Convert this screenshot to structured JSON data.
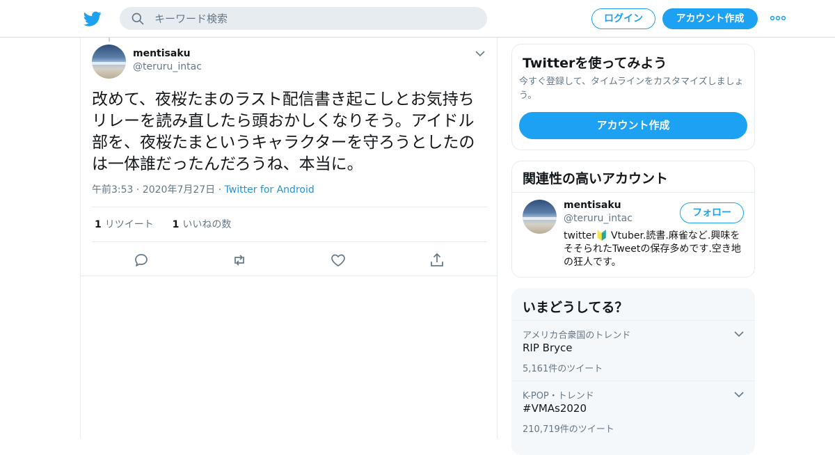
{
  "header": {
    "search_placeholder": "キーワード検索",
    "login_label": "ログイン",
    "signup_label": "アカウント作成"
  },
  "tweet": {
    "name": "mentisaku",
    "handle": "@teruru_intac",
    "text": "改めて、夜桜たまのラスト配信書き起こしとお気持ちリレーを読み直したら頭おかしくなりそう。アイドル部を、夜桜たまというキャラクターを守ろうとしたのは一体誰だったんだろうね、本当に。",
    "time": "午前3:53",
    "date": "2020年7月27日",
    "source": "Twitter for Android",
    "retweet_count": "1",
    "retweet_label": "リツイート",
    "like_count": "1",
    "like_label": "いいねの数"
  },
  "cta_card": {
    "title": "Twitterを使ってみよう",
    "subtitle": "今すぐ登録して、タイムラインをカスタマイズしましょう。",
    "button": "アカウント作成"
  },
  "related": {
    "title": "関連性の高いアカウント",
    "name": "mentisaku",
    "handle": "@teruru_intac",
    "follow_label": "フォロー",
    "bio": "twitter🔰 Vtuber.読書.麻雀など.興味をそそられたTweetの保存多めです.空き地の狂人です。"
  },
  "trends": {
    "title": "いまどうしてる？",
    "items": [
      {
        "context": "アメリカ合衆国のトレンド",
        "name": "RIP Bryce",
        "count": "5,161件のツイート"
      },
      {
        "context": "K-POP・トレンド",
        "name": "#VMAs2020",
        "count": "210,719件のツイート"
      }
    ]
  },
  "colors": {
    "accent": "#1da1f2",
    "secondary_text": "#657786"
  },
  "icons": [
    "twitter-logo-icon",
    "search-icon",
    "more-icon",
    "chevron-down-icon",
    "reply-icon",
    "retweet-icon",
    "like-icon",
    "share-icon"
  ]
}
